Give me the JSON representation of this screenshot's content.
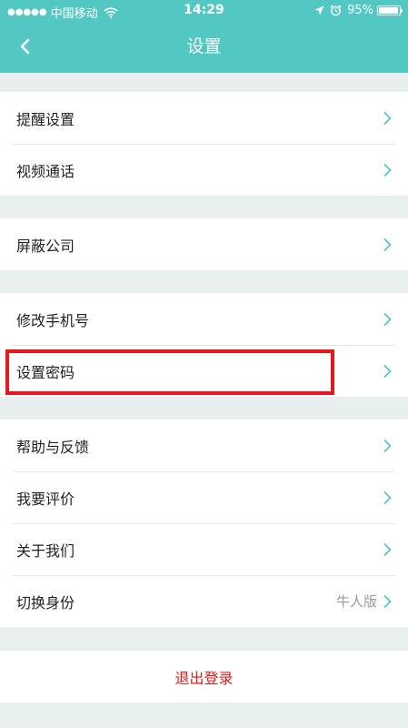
{
  "status_bar": {
    "signal": "●●●●●",
    "carrier": "中国移动",
    "time": "14:29",
    "battery_text": "95%",
    "battery_level": 0.95
  },
  "nav": {
    "title": "设置"
  },
  "groups": [
    {
      "items": [
        {
          "label": "提醒设置"
        },
        {
          "label": "视频通话"
        }
      ]
    },
    {
      "items": [
        {
          "label": "屏蔽公司"
        }
      ]
    },
    {
      "items": [
        {
          "label": "修改手机号"
        },
        {
          "label": "设置密码"
        }
      ]
    },
    {
      "items": [
        {
          "label": "帮助与反馈"
        },
        {
          "label": "我要评价"
        },
        {
          "label": "关于我们"
        },
        {
          "label": "切换身份",
          "value": "牛人版"
        }
      ]
    }
  ],
  "logout": {
    "label": "退出登录"
  },
  "colors": {
    "header": "#53c8c3",
    "chevron": "#4cc4be",
    "logout_text": "#e21b1b",
    "highlight_border": "#e8151b",
    "background": "#e9eeee"
  }
}
